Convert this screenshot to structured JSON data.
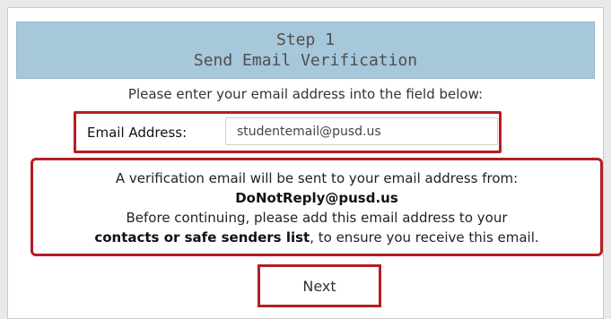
{
  "header": {
    "step": "Step 1",
    "title": "Send Email Verification"
  },
  "instruction": "Please enter your email address into the field below:",
  "email": {
    "label": "Email Address:",
    "value": "studentemail@pusd.us"
  },
  "notice": {
    "line1": "A verification email will be sent to your email address from:",
    "sender": "DoNotReply@pusd.us",
    "line3": "Before continuing, please add this email address to your",
    "emphasis": "contacts or safe senders list",
    "line4_suffix": ", to ensure you receive this email."
  },
  "next_button": "Next",
  "colors": {
    "header_bg": "#a7c7da",
    "highlight_border": "#b41e24"
  }
}
